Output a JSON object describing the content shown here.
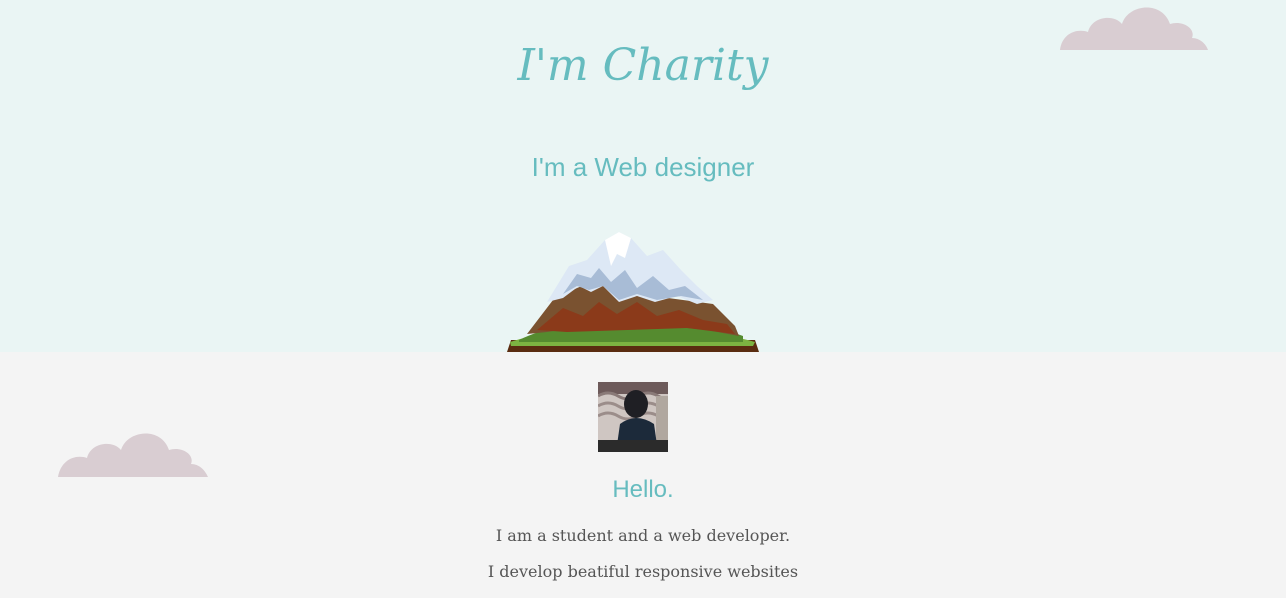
{
  "hero": {
    "name": "I'm Charity",
    "role": "I'm a Web designer"
  },
  "about": {
    "greeting": "Hello.",
    "lines": [
      "I am a student and a web developer.",
      "I develop beatiful responsive websites"
    ]
  },
  "colors": {
    "accent": "#66bcbf",
    "top_bg": "#eaf5f4",
    "bottom_bg": "#f4f4f4",
    "cloud": "#d9cdd2",
    "text": "#555555"
  },
  "icons": {
    "cloud": "cloud-icon",
    "mountain": "mountain-illustration"
  }
}
